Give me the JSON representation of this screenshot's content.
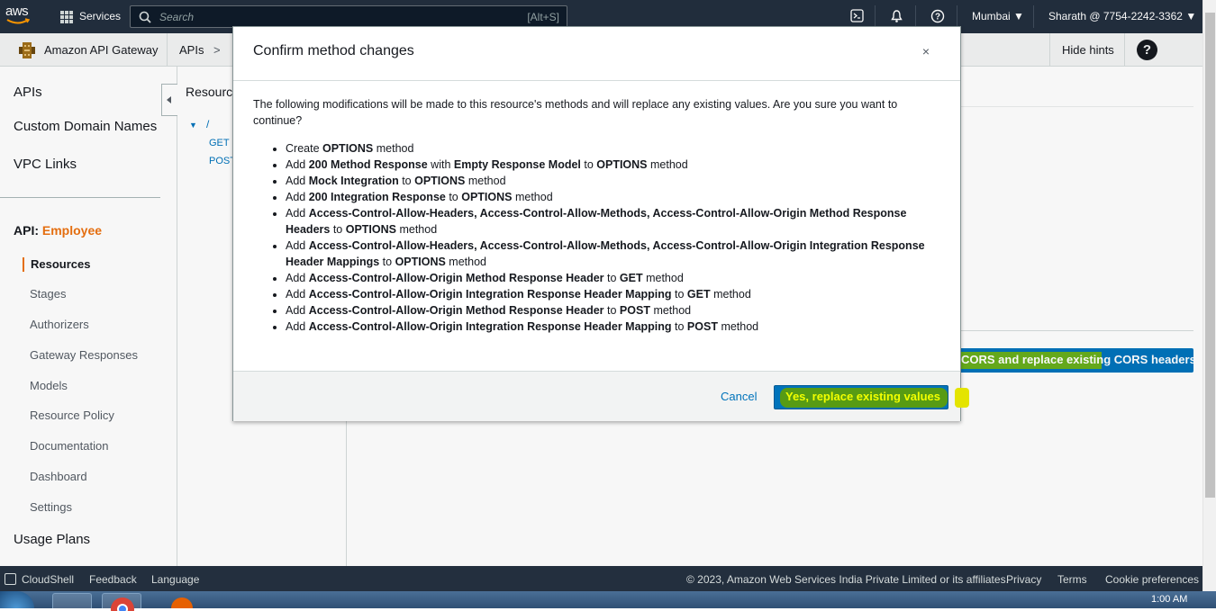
{
  "topnav": {
    "logo": "aws",
    "services_label": "Services",
    "search_placeholder": "Search",
    "search_shortcut": "[Alt+S]",
    "region": "Mumbai",
    "account": "Sharath @ 7754-2242-3362"
  },
  "subbar": {
    "service_name": "Amazon API Gateway",
    "crumb_apis": "APIs",
    "crumb_sep": ">",
    "hide_hints": "Hide hints",
    "help": "?"
  },
  "sidebar": {
    "top_items": [
      "APIs",
      "Custom Domain Names",
      "VPC Links"
    ],
    "api_prefix": "API:",
    "api_name": "Employee",
    "sub_items": [
      "Resources",
      "Stages",
      "Authorizers",
      "Gateway Responses",
      "Models",
      "Resource Policy",
      "Documentation",
      "Dashboard",
      "Settings"
    ],
    "usage_plans": "Usage Plans"
  },
  "resources": {
    "title": "Resource",
    "root": "/",
    "methods": [
      "GET",
      "POST"
    ]
  },
  "background_button": "CORS and replace existing CORS headers",
  "modal": {
    "title": "Confirm method changes",
    "close": "×",
    "intro": "The following modifications will be made to this resource's methods and will replace any existing values. Are you sure you want to continue?",
    "items": [
      [
        [
          "Create ",
          0
        ],
        [
          "OPTIONS",
          1
        ],
        [
          " method",
          0
        ]
      ],
      [
        [
          "Add ",
          0
        ],
        [
          "200 Method Response",
          1
        ],
        [
          " with ",
          0
        ],
        [
          "Empty Response Model",
          1
        ],
        [
          " to ",
          0
        ],
        [
          "OPTIONS",
          1
        ],
        [
          " method",
          0
        ]
      ],
      [
        [
          "Add ",
          0
        ],
        [
          "Mock Integration",
          1
        ],
        [
          " to ",
          0
        ],
        [
          "OPTIONS",
          1
        ],
        [
          " method",
          0
        ]
      ],
      [
        [
          "Add ",
          0
        ],
        [
          "200 Integration Response",
          1
        ],
        [
          " to ",
          0
        ],
        [
          "OPTIONS",
          1
        ],
        [
          " method",
          0
        ]
      ],
      [
        [
          "Add ",
          0
        ],
        [
          "Access-Control-Allow-Headers, Access-Control-Allow-Methods, Access-Control-Allow-Origin Method Response Headers",
          1
        ],
        [
          " to ",
          0
        ],
        [
          "OPTIONS",
          1
        ],
        [
          " method",
          0
        ]
      ],
      [
        [
          "Add ",
          0
        ],
        [
          "Access-Control-Allow-Headers, Access-Control-Allow-Methods, Access-Control-Allow-Origin Integration Response Header Mappings",
          1
        ],
        [
          " to ",
          0
        ],
        [
          "OPTIONS",
          1
        ],
        [
          " method",
          0
        ]
      ],
      [
        [
          "Add ",
          0
        ],
        [
          "Access-Control-Allow-Origin Method Response Header",
          1
        ],
        [
          " to ",
          0
        ],
        [
          "GET",
          1
        ],
        [
          " method",
          0
        ]
      ],
      [
        [
          "Add ",
          0
        ],
        [
          "Access-Control-Allow-Origin Integration Response Header Mapping",
          1
        ],
        [
          " to ",
          0
        ],
        [
          "GET",
          1
        ],
        [
          " method",
          0
        ]
      ],
      [
        [
          "Add ",
          0
        ],
        [
          "Access-Control-Allow-Origin Method Response Header",
          1
        ],
        [
          " to ",
          0
        ],
        [
          "POST",
          1
        ],
        [
          " method",
          0
        ]
      ],
      [
        [
          "Add ",
          0
        ],
        [
          "Access-Control-Allow-Origin Integration Response Header Mapping",
          1
        ],
        [
          " to ",
          0
        ],
        [
          "POST",
          1
        ],
        [
          " method",
          0
        ]
      ]
    ],
    "cancel": "Cancel",
    "confirm": "Yes, replace existing values"
  },
  "footer": {
    "cloudshell": "CloudShell",
    "feedback": "Feedback",
    "language": "Language",
    "copyright": "© 2023, Amazon Web Services India Private Limited or its affiliates.",
    "privacy": "Privacy",
    "terms": "Terms",
    "cookies": "Cookie preferences"
  },
  "taskbar": {
    "clock": "1:00 AM"
  },
  "colors": {
    "aws_nav": "#232f3e",
    "accent_orange": "#ec7211",
    "link_blue": "#0073bb",
    "highlight_green": "#5e9e05",
    "highlight_yellow": "#e4e400"
  }
}
